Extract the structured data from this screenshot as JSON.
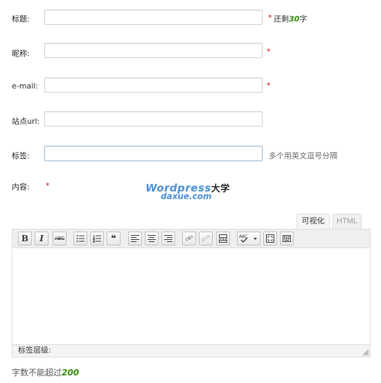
{
  "form": {
    "title_label": "标题:",
    "title_value": "",
    "title_hint_prefix": "还剩",
    "title_hint_count": "30",
    "title_hint_suffix": "字",
    "nickname_label": "昵称:",
    "nickname_value": "",
    "email_label": "e-mail:",
    "email_value": "",
    "site_label": "站点url:",
    "site_value": "",
    "tags_label": "标签:",
    "tags_value": "",
    "tags_note": "多个用英文逗号分隔",
    "content_label": "内容:",
    "required_mark": "*"
  },
  "watermark": {
    "line1": "Wordpress",
    "line1_cn": "大学",
    "line2": "daxue.com"
  },
  "editor": {
    "tab_visual": "可视化",
    "tab_html": "HTML",
    "active_tab": "可视化",
    "toolbar": {
      "bold": "B",
      "italic": "I",
      "strike": "ABC",
      "quote": "❝"
    },
    "content": "",
    "path_label": "标签层级:"
  },
  "footer": {
    "limit_prefix": "字数不能超过",
    "limit_count": "200"
  },
  "colors": {
    "required": "#cc0000",
    "count_green": "#2e8b00",
    "watermark_blue": "#4a8fd6"
  }
}
